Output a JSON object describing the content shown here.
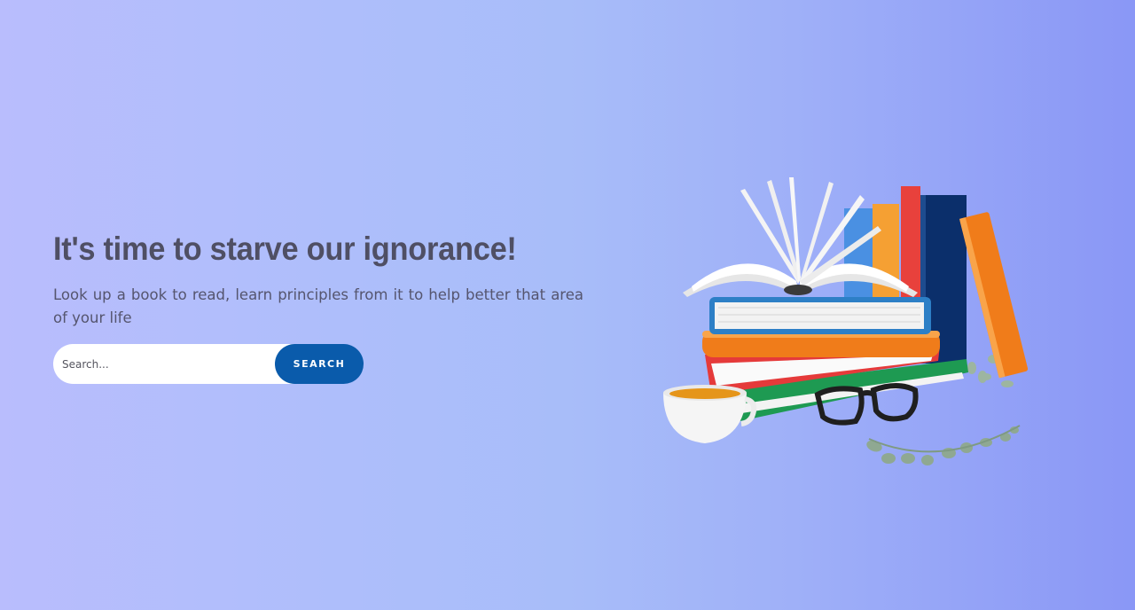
{
  "hero": {
    "title": "It's time to starve our ignorance!",
    "subtitle": "Look up a book to read, learn principles from it to help better that area of your life"
  },
  "search": {
    "placeholder": "Search...",
    "button_label": "SEARCH"
  },
  "illustration": {
    "icon": "books-tea-glasses-illustration"
  },
  "colors": {
    "gradient_start": "#b9bdfd",
    "gradient_end": "#8a97f6",
    "heading": "#4f4f64",
    "body_text": "#55556e",
    "button": "#0a5bab"
  }
}
